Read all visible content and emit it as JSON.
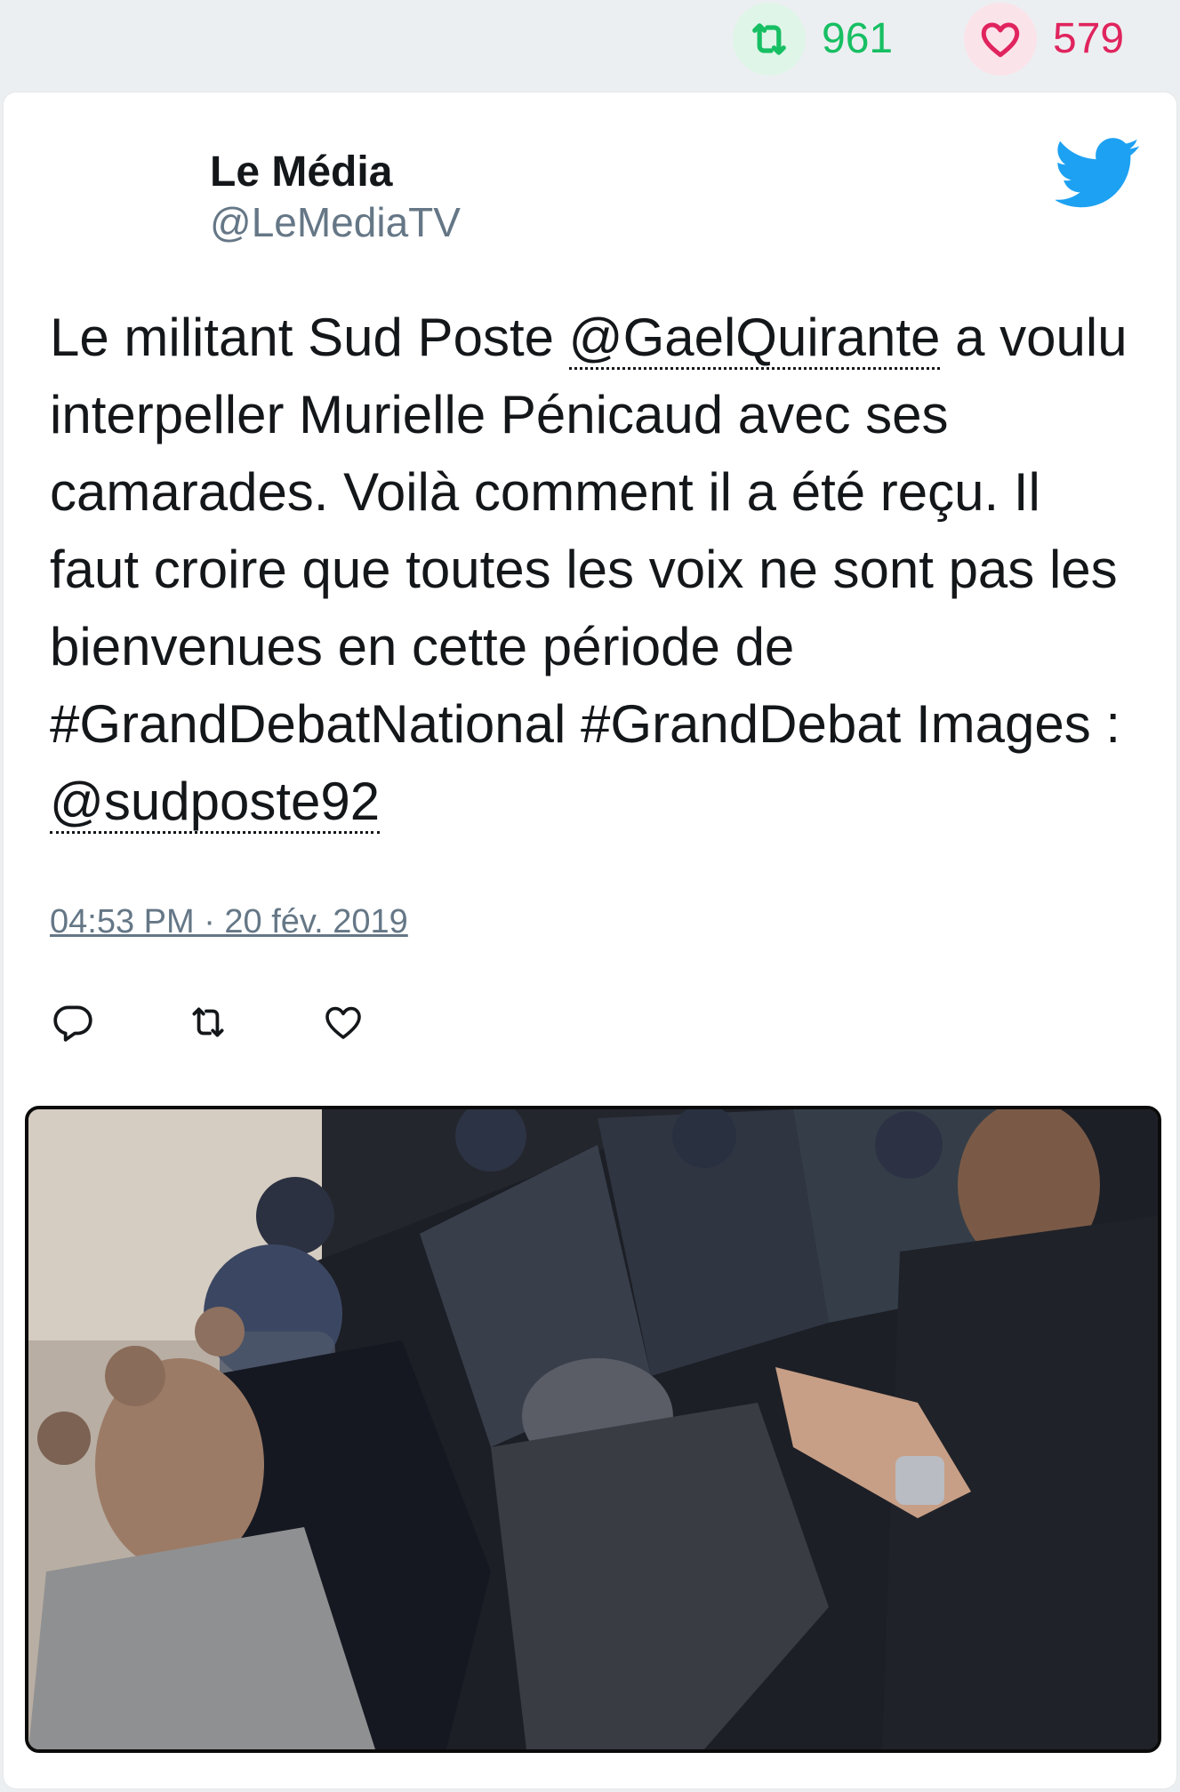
{
  "stats": {
    "retweets": "961",
    "likes": "579"
  },
  "tweet": {
    "author_name": "Le Média",
    "author_handle": "@LeMediaTV",
    "text_part1": "Le militant Sud Poste ",
    "mention1": "@GaelQuirante",
    "text_part2": " a voulu interpeller Murielle Pénicaud avec ses camarades. Voilà comment il a été reçu. Il faut croire que toutes les voix ne sont pas les bienvenues en cette période de #GrandDebatNational #GrandDebat Images : ",
    "mention2": "@sudposte92",
    "timestamp": "04:53 PM · 20 fév. 2019"
  },
  "colors": {
    "retweet_green": "#17bf63",
    "like_red": "#e0245e",
    "twitter_blue": "#1da1f2",
    "secondary_text": "#657786"
  },
  "icons": [
    "retweet-icon",
    "heart-icon",
    "twitter-bird-icon",
    "reply-icon"
  ]
}
